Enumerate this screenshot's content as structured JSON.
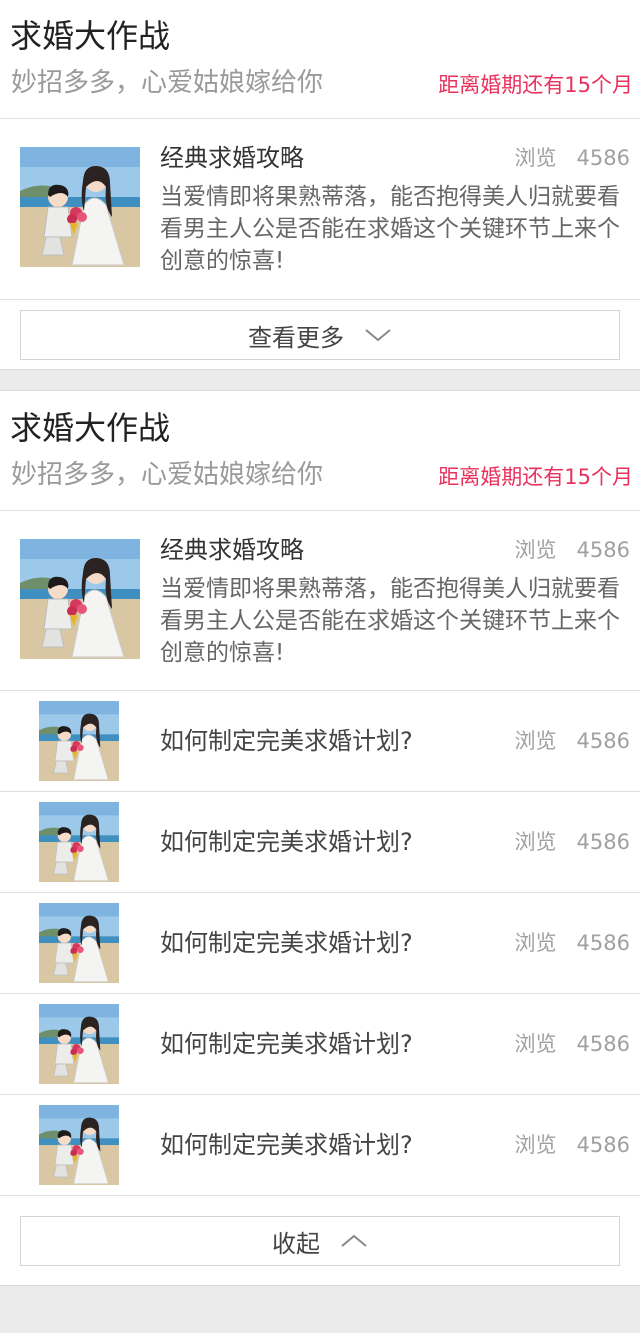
{
  "sections": [
    {
      "title": "求婚大作战",
      "subtitle": "妙招多多，心爱姑娘嫁给你",
      "countdown": "距离婚期还有15个月",
      "featured": {
        "title": "经典求婚攻略",
        "views_label": "浏览",
        "views_count": "4586",
        "description": "当爱情即将果熟蒂落，能否抱得美人归就要看看男主人公是否能在求婚这个关键环节上来个创意的惊喜!"
      },
      "toggle_label": "查看更多",
      "toggle_icon": "chevron-down-icon"
    },
    {
      "title": "求婚大作战",
      "subtitle": "妙招多多，心爱姑娘嫁给你",
      "countdown": "距离婚期还有15个月",
      "featured": {
        "title": "经典求婚攻略",
        "views_label": "浏览",
        "views_count": "4586",
        "description": "当爱情即将果熟蒂落，能否抱得美人归就要看看男主人公是否能在求婚这个关键环节上来个创意的惊喜!"
      },
      "items": [
        {
          "title": "如何制定完美求婚计划?",
          "views_label": "浏览",
          "views_count": "4586"
        },
        {
          "title": "如何制定完美求婚计划?",
          "views_label": "浏览",
          "views_count": "4586"
        },
        {
          "title": "如何制定完美求婚计划?",
          "views_label": "浏览",
          "views_count": "4586"
        },
        {
          "title": "如何制定完美求婚计划?",
          "views_label": "浏览",
          "views_count": "4586"
        },
        {
          "title": "如何制定完美求婚计划?",
          "views_label": "浏览",
          "views_count": "4586"
        }
      ],
      "toggle_label": "收起",
      "toggle_icon": "chevron-up-icon"
    }
  ],
  "colors": {
    "accent": "#e9315c",
    "background": "#ebebeb",
    "text": "#333333",
    "muted": "#9a9a9a"
  }
}
